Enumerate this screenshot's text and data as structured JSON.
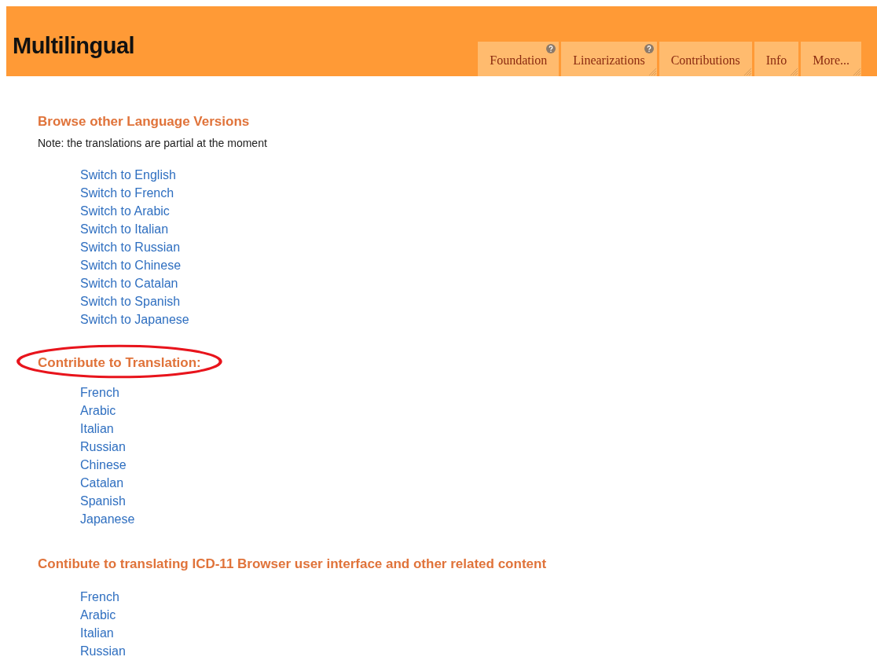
{
  "header": {
    "title": "Multilingual",
    "tabs": [
      {
        "label": "Foundation",
        "help": true,
        "grip": false
      },
      {
        "label": "Linearizations",
        "help": true,
        "grip": true
      },
      {
        "label": "Contributions",
        "help": false,
        "grip": true
      },
      {
        "label": "Info",
        "help": false,
        "grip": true
      },
      {
        "label": "More...",
        "help": false,
        "grip": true
      }
    ]
  },
  "sections": [
    {
      "heading": "Browse other Language Versions",
      "circled": false,
      "note": "Note: the translations are partial at the moment",
      "links": [
        "Switch to English",
        "Switch to French",
        "Switch to Arabic",
        "Switch to Italian",
        "Switch to Russian",
        "Switch to Chinese",
        "Switch to Catalan",
        "Switch to Spanish",
        "Switch to Japanese"
      ]
    },
    {
      "heading": "Contribute to Translation:",
      "circled": true,
      "links": [
        "French",
        "Arabic",
        "Italian",
        "Russian",
        "Chinese",
        "Catalan",
        "Spanish",
        "Japanese"
      ]
    },
    {
      "heading": "Contibute to translating ICD-11 Browser user interface and other related content",
      "circled": false,
      "links": [
        "French",
        "Arabic",
        "Italian",
        "Russian"
      ]
    }
  ]
}
